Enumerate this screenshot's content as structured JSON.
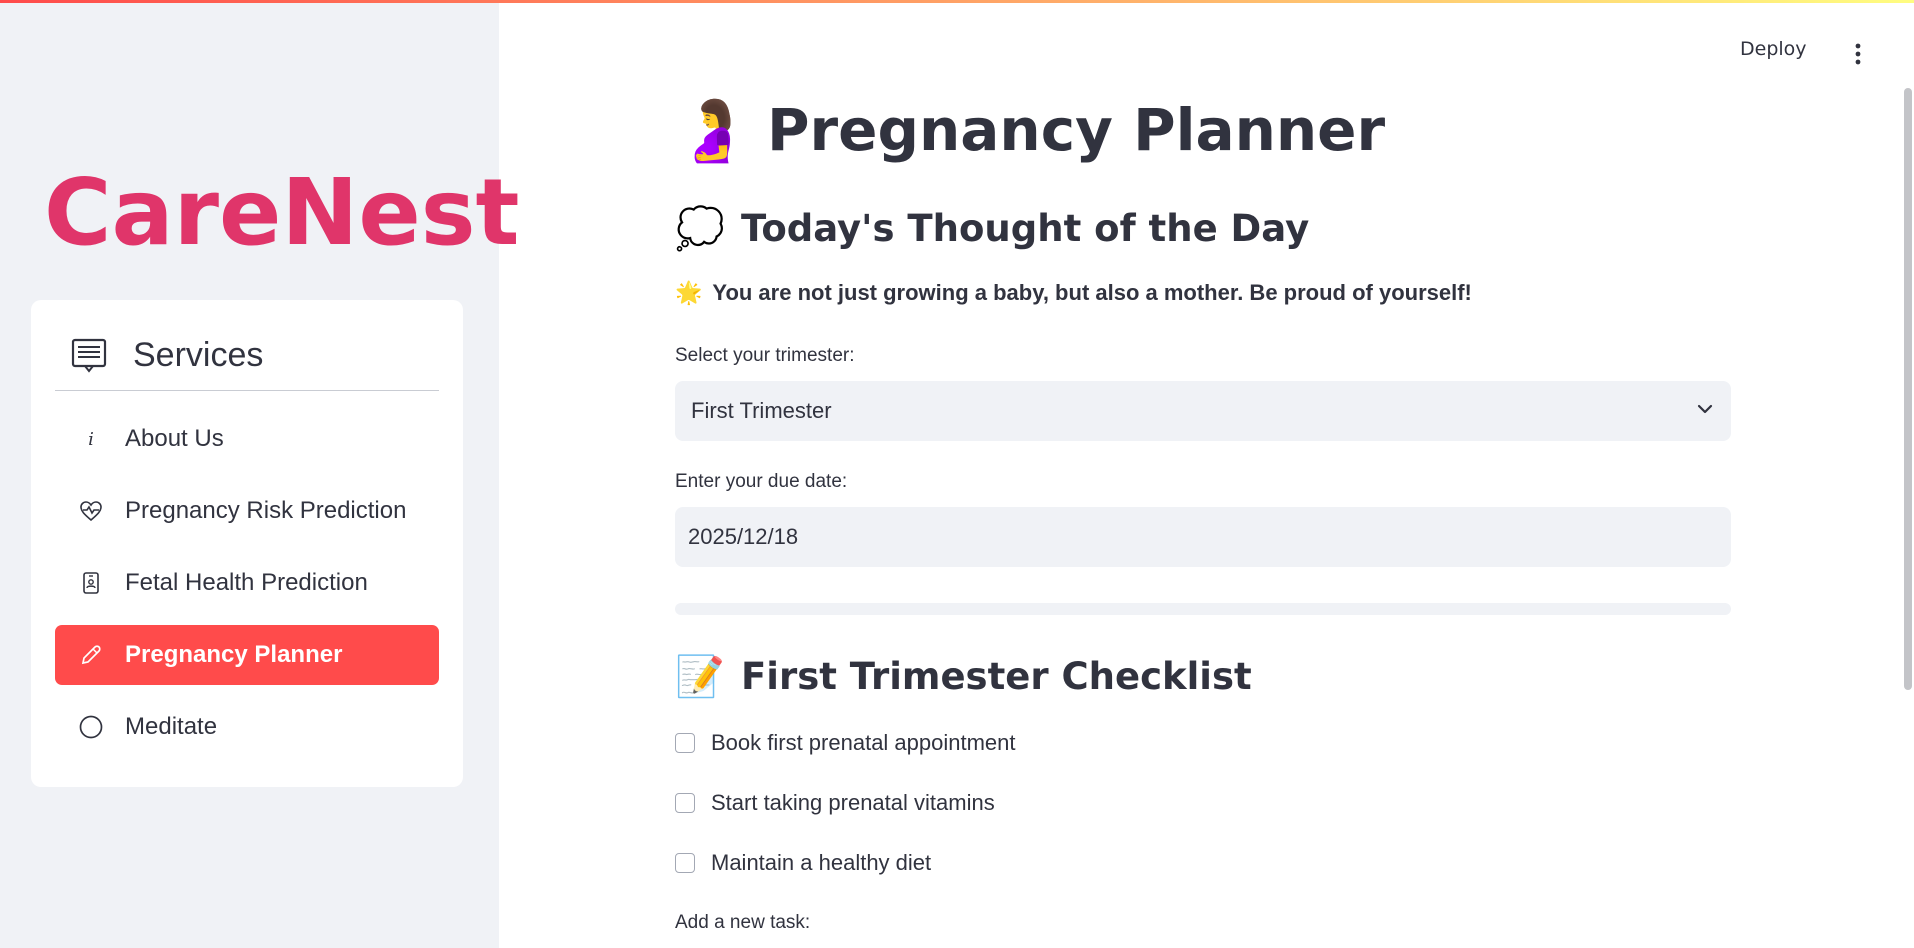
{
  "app": {
    "brand": "CareNest"
  },
  "sidebar": {
    "menu_title": "Services",
    "items": [
      {
        "label": "About Us",
        "icon": "info-icon",
        "active": false
      },
      {
        "label": "Pregnancy Risk Prediction",
        "icon": "heart-pulse-icon",
        "active": false
      },
      {
        "label": "Fetal Health Prediction",
        "icon": "person-badge-icon",
        "active": false
      },
      {
        "label": "Pregnancy Planner",
        "icon": "pencil-icon",
        "active": true
      },
      {
        "label": "Meditate",
        "icon": "circle-icon",
        "active": false
      }
    ]
  },
  "header": {
    "deploy_label": "Deploy",
    "menu_icon": "kebab-icon"
  },
  "main": {
    "title_emoji": "🤰",
    "title": "Pregnancy Planner",
    "thought_emoji": "💭",
    "thought_heading": "Today's Thought of the Day",
    "quote_emoji": "🌟",
    "quote": "You are not just growing a baby, but also a mother. Be proud of yourself!",
    "trimester_label": "Select your trimester:",
    "trimester_value": "First Trimester",
    "due_date_label": "Enter your due date:",
    "due_date_value": "2025/12/18",
    "progress": 0,
    "checklist_emoji": "📝",
    "checklist_heading": "First Trimester Checklist",
    "checklist": [
      "Book first prenatal appointment",
      "Start taking prenatal vitamins",
      "Maintain a healthy diet"
    ],
    "add_task_label": "Add a new task:"
  },
  "colors": {
    "accent": "#ff4b4b",
    "brand": "#e0356a",
    "sidebar_bg": "#f0f2f6"
  }
}
